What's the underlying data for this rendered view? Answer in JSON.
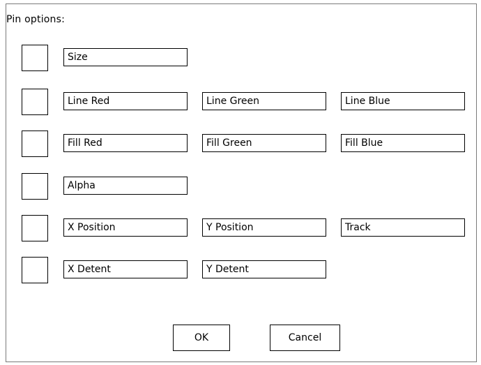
{
  "dialog": {
    "title": "Pin options:",
    "rows": [
      {
        "fields": [
          "Size"
        ]
      },
      {
        "fields": [
          "Line Red",
          "Line Green",
          "Line Blue"
        ]
      },
      {
        "fields": [
          "Fill Red",
          "Fill Green",
          "Fill Blue"
        ]
      },
      {
        "fields": [
          "Alpha"
        ]
      },
      {
        "fields": [
          "X Position",
          "Y Position",
          "Track"
        ]
      },
      {
        "fields": [
          "X Detent",
          "Y Detent"
        ]
      }
    ],
    "buttons": {
      "ok": "OK",
      "cancel": "Cancel"
    }
  }
}
